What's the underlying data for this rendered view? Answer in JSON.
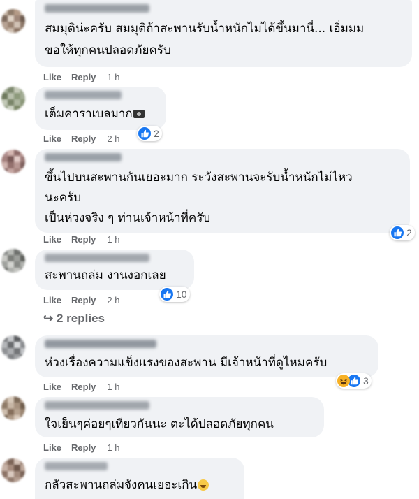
{
  "actions": {
    "like": "Like",
    "reply": "Reply"
  },
  "comments": [
    {
      "lines": [
        "สมมุติน่ะครับ สมมุติถ้าสะพานรับน้ำหนักไม่ได้ขึ้นมานี่... เอิ่มมม",
        "ขอให้ทุกคนปลอดภัยครับ"
      ],
      "time": "1 h",
      "reactions": null
    },
    {
      "lines": [
        "เต็มคาราเบลมาก"
      ],
      "time": "2 h",
      "reactions": {
        "icons": [
          "like-icon"
        ],
        "count": "2"
      }
    },
    {
      "lines": [
        "ขึ้นไปบนสะพานกันเยอะมาก ระวังสะพานจะรับน้ำหนักไม่ไหว",
        "นะครับ",
        "เป็นห่วงจริง ๆ ท่านเจ้าหน้าที่ครับ"
      ],
      "time": "1 h",
      "reactions": {
        "icons": [
          "like-icon"
        ],
        "count": "2"
      }
    },
    {
      "lines": [
        "สะพานถล่ม งานงอกเลย"
      ],
      "time": "2 h",
      "reactions": {
        "icons": [
          "like-icon"
        ],
        "count": "10"
      }
    },
    {
      "lines": [
        "ห่วงเรื่องความแข็งแรงของสะพาน มีเจ้าหน้าที่ดูไหมครับ"
      ],
      "time": "1 h",
      "reactions": {
        "icons": [
          "haha-icon",
          "like-icon"
        ],
        "count": "3"
      }
    },
    {
      "lines": [
        "ใจเย็นๆค่อยๆเทียวกันนะ ตะได้ปลอดภัยทุกคน"
      ],
      "time": "1 h",
      "reactions": null
    },
    {
      "lines": [
        "กลัวสะพานถล่มจังคนเยอะเกิน"
      ],
      "time": "",
      "reactions": null
    }
  ],
  "view_replies": {
    "arrow": "↪",
    "label": "2 replies"
  },
  "colors": {
    "bubble": "#f0f2f5",
    "like_blue": "#1877f2",
    "meta_gray": "#65676b"
  }
}
